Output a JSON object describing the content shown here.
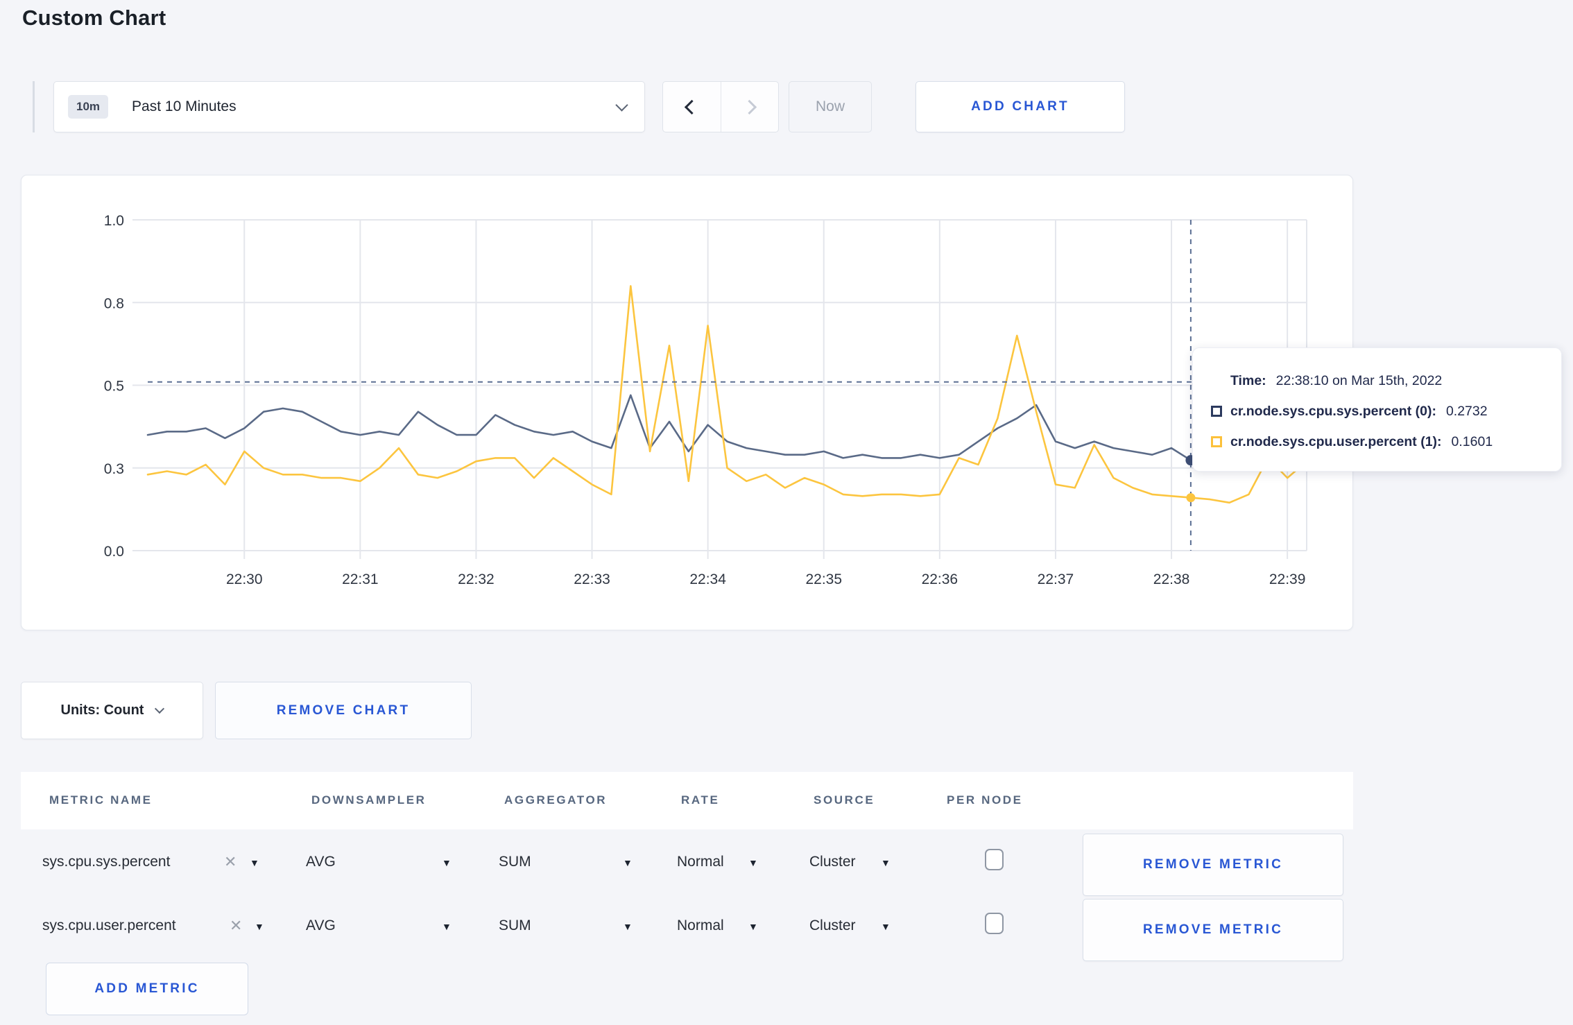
{
  "page": {
    "title": "Custom Chart"
  },
  "toolbar": {
    "time_selector": {
      "badge": "10m",
      "label": "Past 10 Minutes"
    },
    "now_label": "Now",
    "add_chart_label": "ADD CHART",
    "icons": {
      "time_selector": "chevron-down-icon",
      "prev": "chevron-left-icon",
      "next": "chevron-right-icon"
    }
  },
  "tooltip": {
    "time_label": "Time:",
    "time_value": "22:38:10 on Mar 15th, 2022",
    "rows": [
      {
        "label": "cr.node.sys.cpu.sys.percent (0):",
        "value": "0.2732",
        "color": "#2c3a5e"
      },
      {
        "label": "cr.node.sys.cpu.user.percent (1):",
        "value": "0.1601",
        "color": "#fcc13b"
      }
    ]
  },
  "chart_data": {
    "type": "line",
    "title": "",
    "xlabel": "",
    "ylabel": "",
    "x_start": "22:29:10",
    "x_step_seconds": 10,
    "x_window": "Past 10 Minutes",
    "x_tick_labels": [
      "22:30",
      "22:31",
      "22:32",
      "22:33",
      "22:34",
      "22:35",
      "22:36",
      "22:37",
      "22:38",
      "22:39"
    ],
    "y_tick_values": [
      0,
      0.25,
      0.5,
      0.75,
      1.0
    ],
    "y_tick_labels": [
      "0.0",
      "0.3",
      "0.5",
      "0.8",
      "1.0"
    ],
    "ylim": [
      0,
      1
    ],
    "grid": true,
    "legend_position": "tooltip-only",
    "series": [
      {
        "name": "cr.node.sys.cpu.sys.percent (0)",
        "color": "#5a6a87",
        "values": [
          0.35,
          0.36,
          0.36,
          0.37,
          0.34,
          0.37,
          0.42,
          0.43,
          0.42,
          0.39,
          0.36,
          0.35,
          0.36,
          0.35,
          0.42,
          0.38,
          0.35,
          0.35,
          0.41,
          0.38,
          0.36,
          0.35,
          0.36,
          0.33,
          0.31,
          0.47,
          0.31,
          0.39,
          0.3,
          0.38,
          0.33,
          0.31,
          0.3,
          0.29,
          0.29,
          0.3,
          0.28,
          0.29,
          0.28,
          0.28,
          0.29,
          0.28,
          0.29,
          0.33,
          0.37,
          0.4,
          0.44,
          0.33,
          0.31,
          0.33,
          0.31,
          0.3,
          0.29,
          0.31,
          0.2732,
          0.3,
          0.3,
          0.3,
          0.29,
          0.3,
          0.3
        ]
      },
      {
        "name": "cr.node.sys.cpu.user.percent (1)",
        "color": "#fcc53f",
        "values": [
          0.23,
          0.24,
          0.23,
          0.26,
          0.2,
          0.3,
          0.25,
          0.23,
          0.23,
          0.22,
          0.22,
          0.21,
          0.25,
          0.31,
          0.23,
          0.22,
          0.24,
          0.27,
          0.28,
          0.28,
          0.22,
          0.28,
          0.24,
          0.2,
          0.17,
          0.8,
          0.3,
          0.62,
          0.21,
          0.68,
          0.25,
          0.21,
          0.23,
          0.19,
          0.22,
          0.2,
          0.17,
          0.165,
          0.17,
          0.17,
          0.165,
          0.17,
          0.28,
          0.26,
          0.4,
          0.65,
          0.42,
          0.2,
          0.19,
          0.32,
          0.22,
          0.19,
          0.17,
          0.165,
          0.1601,
          0.155,
          0.145,
          0.17,
          0.28,
          0.22,
          0.27
        ]
      }
    ],
    "crosshair": {
      "point_index": 54,
      "time": "22:38:10 on Mar 15th, 2022",
      "hline_value": 0.51,
      "values": {
        "sys": 0.2732,
        "user": 0.1601
      }
    }
  },
  "units_row": {
    "units_label": "Units: Count",
    "remove_chart_label": "REMOVE CHART",
    "units_icon": "chevron-down-icon"
  },
  "table": {
    "headers": [
      "METRIC NAME",
      "DOWNSAMPLER",
      "AGGREGATOR",
      "RATE",
      "SOURCE",
      "PER NODE"
    ],
    "remove_metric_label": "REMOVE METRIC",
    "add_metric_label": "ADD METRIC",
    "x_glyph": "✕",
    "caret_glyph": "▼",
    "rows": [
      {
        "metric": "sys.cpu.sys.percent",
        "downsampler": "AVG",
        "aggregator": "SUM",
        "rate": "Normal",
        "source": "Cluster",
        "per_node_checked": false
      },
      {
        "metric": "sys.cpu.user.percent",
        "downsampler": "AVG",
        "aggregator": "SUM",
        "rate": "Normal",
        "source": "Cluster",
        "per_node_checked": false
      }
    ]
  }
}
